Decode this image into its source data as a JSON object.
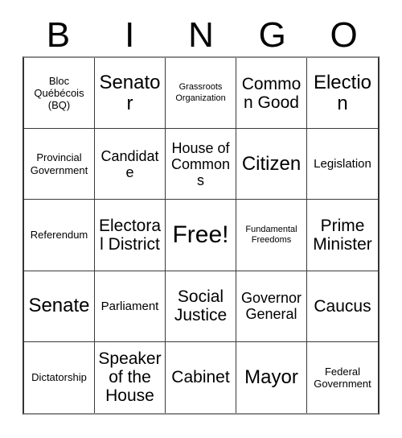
{
  "card": {
    "header_letters": [
      "B",
      "I",
      "N",
      "G",
      "O"
    ],
    "grid": {
      "rows": 5,
      "cols": 5,
      "cells": [
        {
          "text": "Bloc Québécois (BQ)",
          "size": "sm"
        },
        {
          "text": "Senator",
          "size": "xxl"
        },
        {
          "text": "Grassroots Organization",
          "size": "xs"
        },
        {
          "text": "Common Good",
          "size": "xl"
        },
        {
          "text": "Election",
          "size": "xxl"
        },
        {
          "text": "Provincial Government",
          "size": "sm"
        },
        {
          "text": "Candidate",
          "size": "lg"
        },
        {
          "text": "House of Commons",
          "size": "lg"
        },
        {
          "text": "Citizen",
          "size": "xxl"
        },
        {
          "text": "Legislation",
          "size": "md"
        },
        {
          "text": "Referendum",
          "size": "sm"
        },
        {
          "text": "Electoral District",
          "size": "xl"
        },
        {
          "text": "Free!",
          "size": "free"
        },
        {
          "text": "Fundamental Freedoms",
          "size": "xs"
        },
        {
          "text": "Prime Minister",
          "size": "xl"
        },
        {
          "text": "Senate",
          "size": "xxl"
        },
        {
          "text": "Parliament",
          "size": "md"
        },
        {
          "text": "Social Justice",
          "size": "xl"
        },
        {
          "text": "Governor General",
          "size": "lg"
        },
        {
          "text": "Caucus",
          "size": "xl"
        },
        {
          "text": "Dictatorship",
          "size": "sm"
        },
        {
          "text": "Speaker of the House",
          "size": "xl"
        },
        {
          "text": "Cabinet",
          "size": "xl"
        },
        {
          "text": "Mayor",
          "size": "xxl"
        },
        {
          "text": "Federal Government",
          "size": "sm"
        }
      ]
    }
  },
  "colors": {
    "background": "#ffffff",
    "text": "#000000",
    "grid_line": "#3a3a3a",
    "outer_border": "#8c8c8c"
  }
}
